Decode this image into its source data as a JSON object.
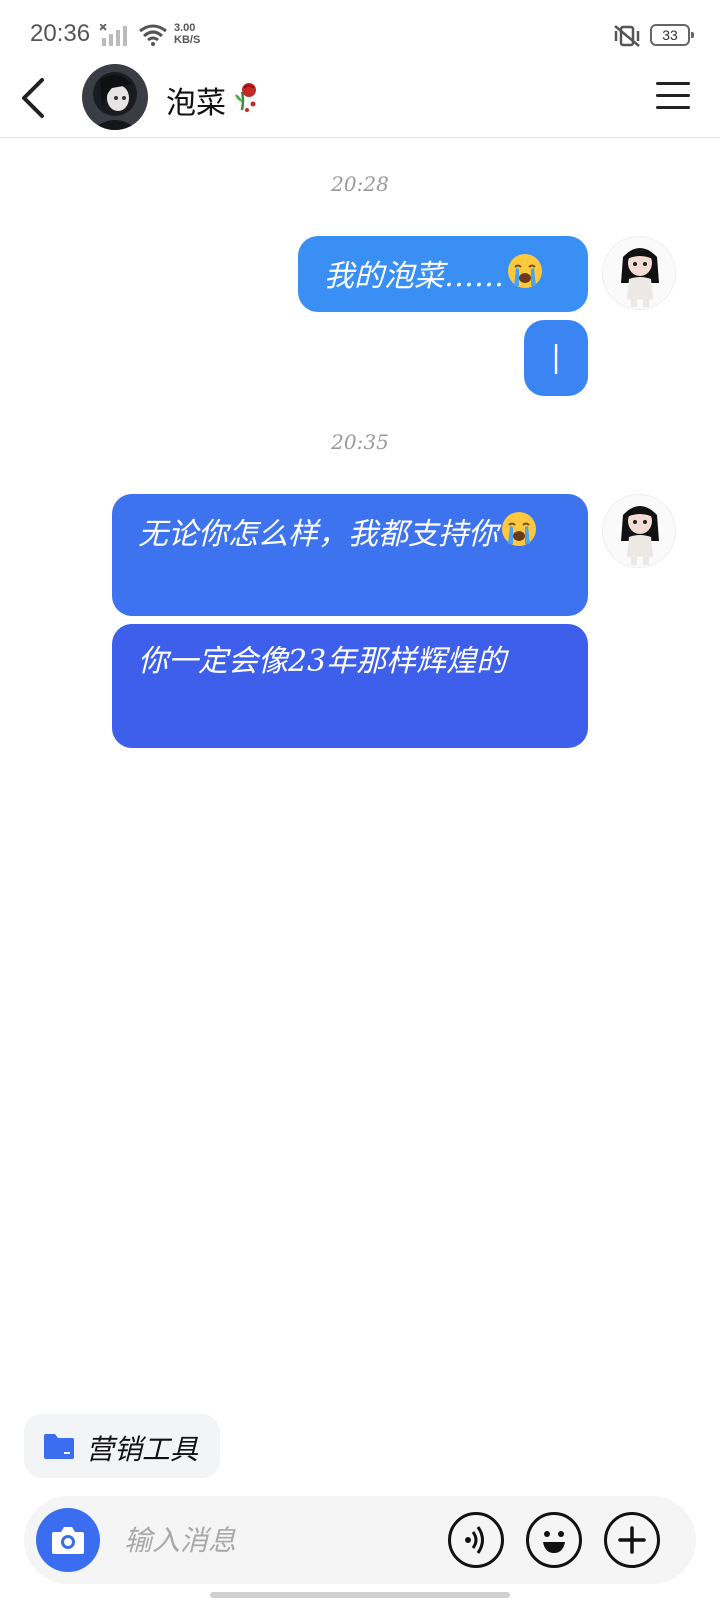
{
  "status_bar": {
    "time": "20:36",
    "net_speed_value": "3.00",
    "net_speed_unit": "KB/S",
    "battery": "33",
    "icons": [
      "signal-icon",
      "wifi-icon",
      "mute-vibrate-icon",
      "battery-icon"
    ]
  },
  "header": {
    "contact_name": "泡菜",
    "name_emoji": "🥀",
    "icons": [
      "back-arrow-icon",
      "menu-icon"
    ]
  },
  "chat": {
    "groups": [
      {
        "time": "20:28",
        "messages": [
          "我的泡菜……😭",
          "|"
        ]
      },
      {
        "time": "20:35",
        "messages": [
          "无论你怎么样，我都支持你😭",
          "你一定会像23年那样辉煌的"
        ]
      }
    ]
  },
  "tools": {
    "marketing_label": "营销工具"
  },
  "input": {
    "placeholder": "输入消息",
    "value": "",
    "icons": [
      "camera-icon",
      "voice-icon",
      "emoji-icon",
      "plus-icon"
    ]
  },
  "colors": {
    "bubble_light": "#3a8ff5",
    "bubble_dark": "#3e60ec",
    "accent": "#3a6df0"
  }
}
